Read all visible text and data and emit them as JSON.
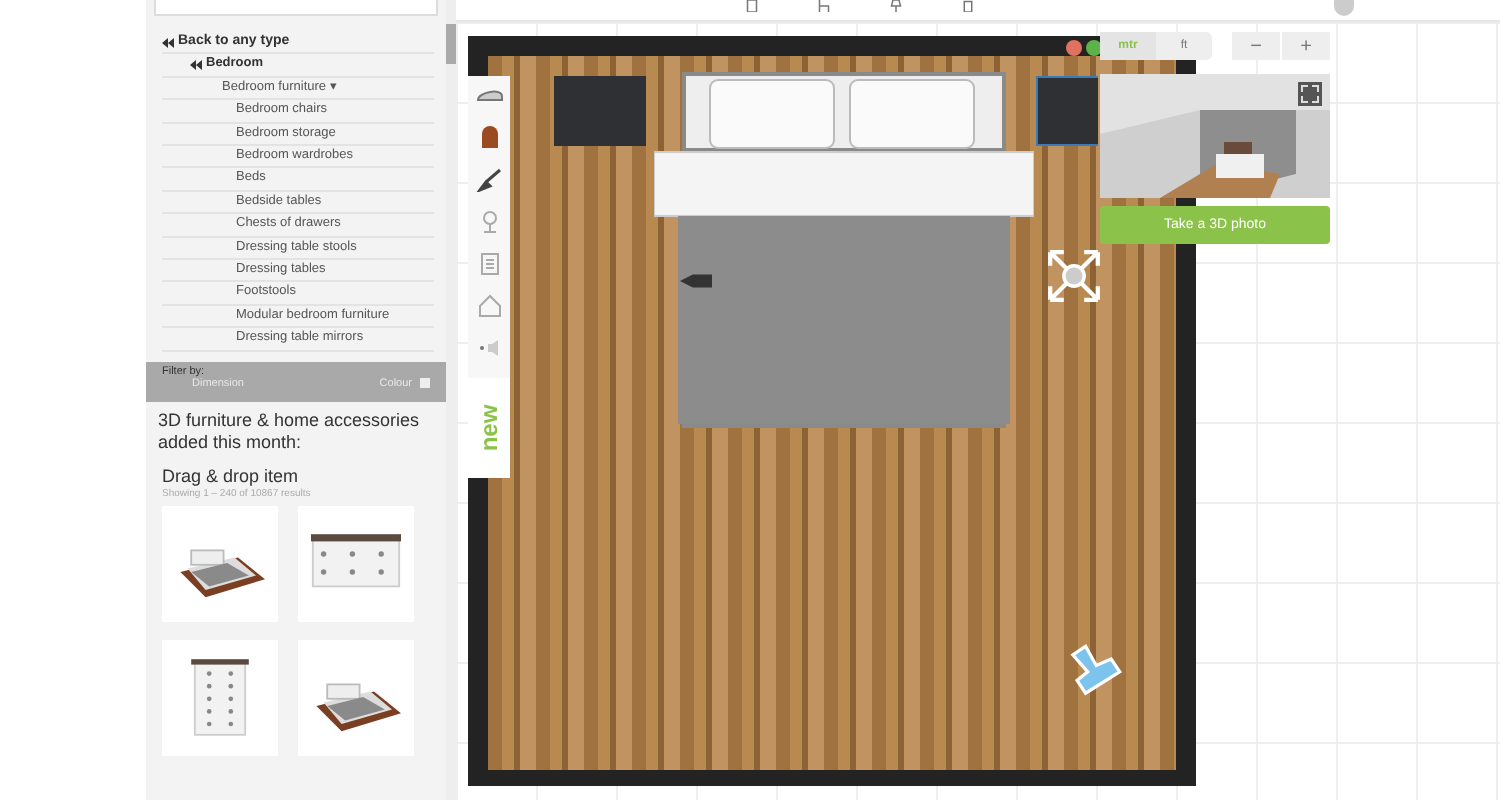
{
  "sidebar": {
    "back_link": "Back to any type",
    "category": "Bedroom",
    "subcategory": "Bedroom furniture ▾",
    "items": [
      "Bedroom chairs",
      "Bedroom storage",
      "Bedroom wardrobes",
      "Beds",
      "Bedside tables",
      "Chests of drawers",
      "Dressing table stools",
      "Dressing tables",
      "Footstools",
      "Modular bedroom furniture",
      "Dressing table mirrors"
    ],
    "filter": {
      "label": "Filter by:",
      "dimension": "Dimension",
      "colour": "Colour",
      "colour_checked": false
    },
    "heading": "3D furniture & home accessories added this month:",
    "section_title": "Drag & drop item",
    "results": "Showing 1 – 240 of 10867 results",
    "products": [
      {
        "kind": "bed"
      },
      {
        "kind": "dresser"
      },
      {
        "kind": "chest"
      },
      {
        "kind": "bed"
      }
    ]
  },
  "tools": {
    "new_tab": "new"
  },
  "units": [
    {
      "label": "mtr",
      "selected": true
    },
    {
      "label": "ft",
      "selected": false
    }
  ],
  "zoom": {
    "out": "−",
    "in": "+"
  },
  "preview": {
    "button": "Take a 3D photo"
  }
}
